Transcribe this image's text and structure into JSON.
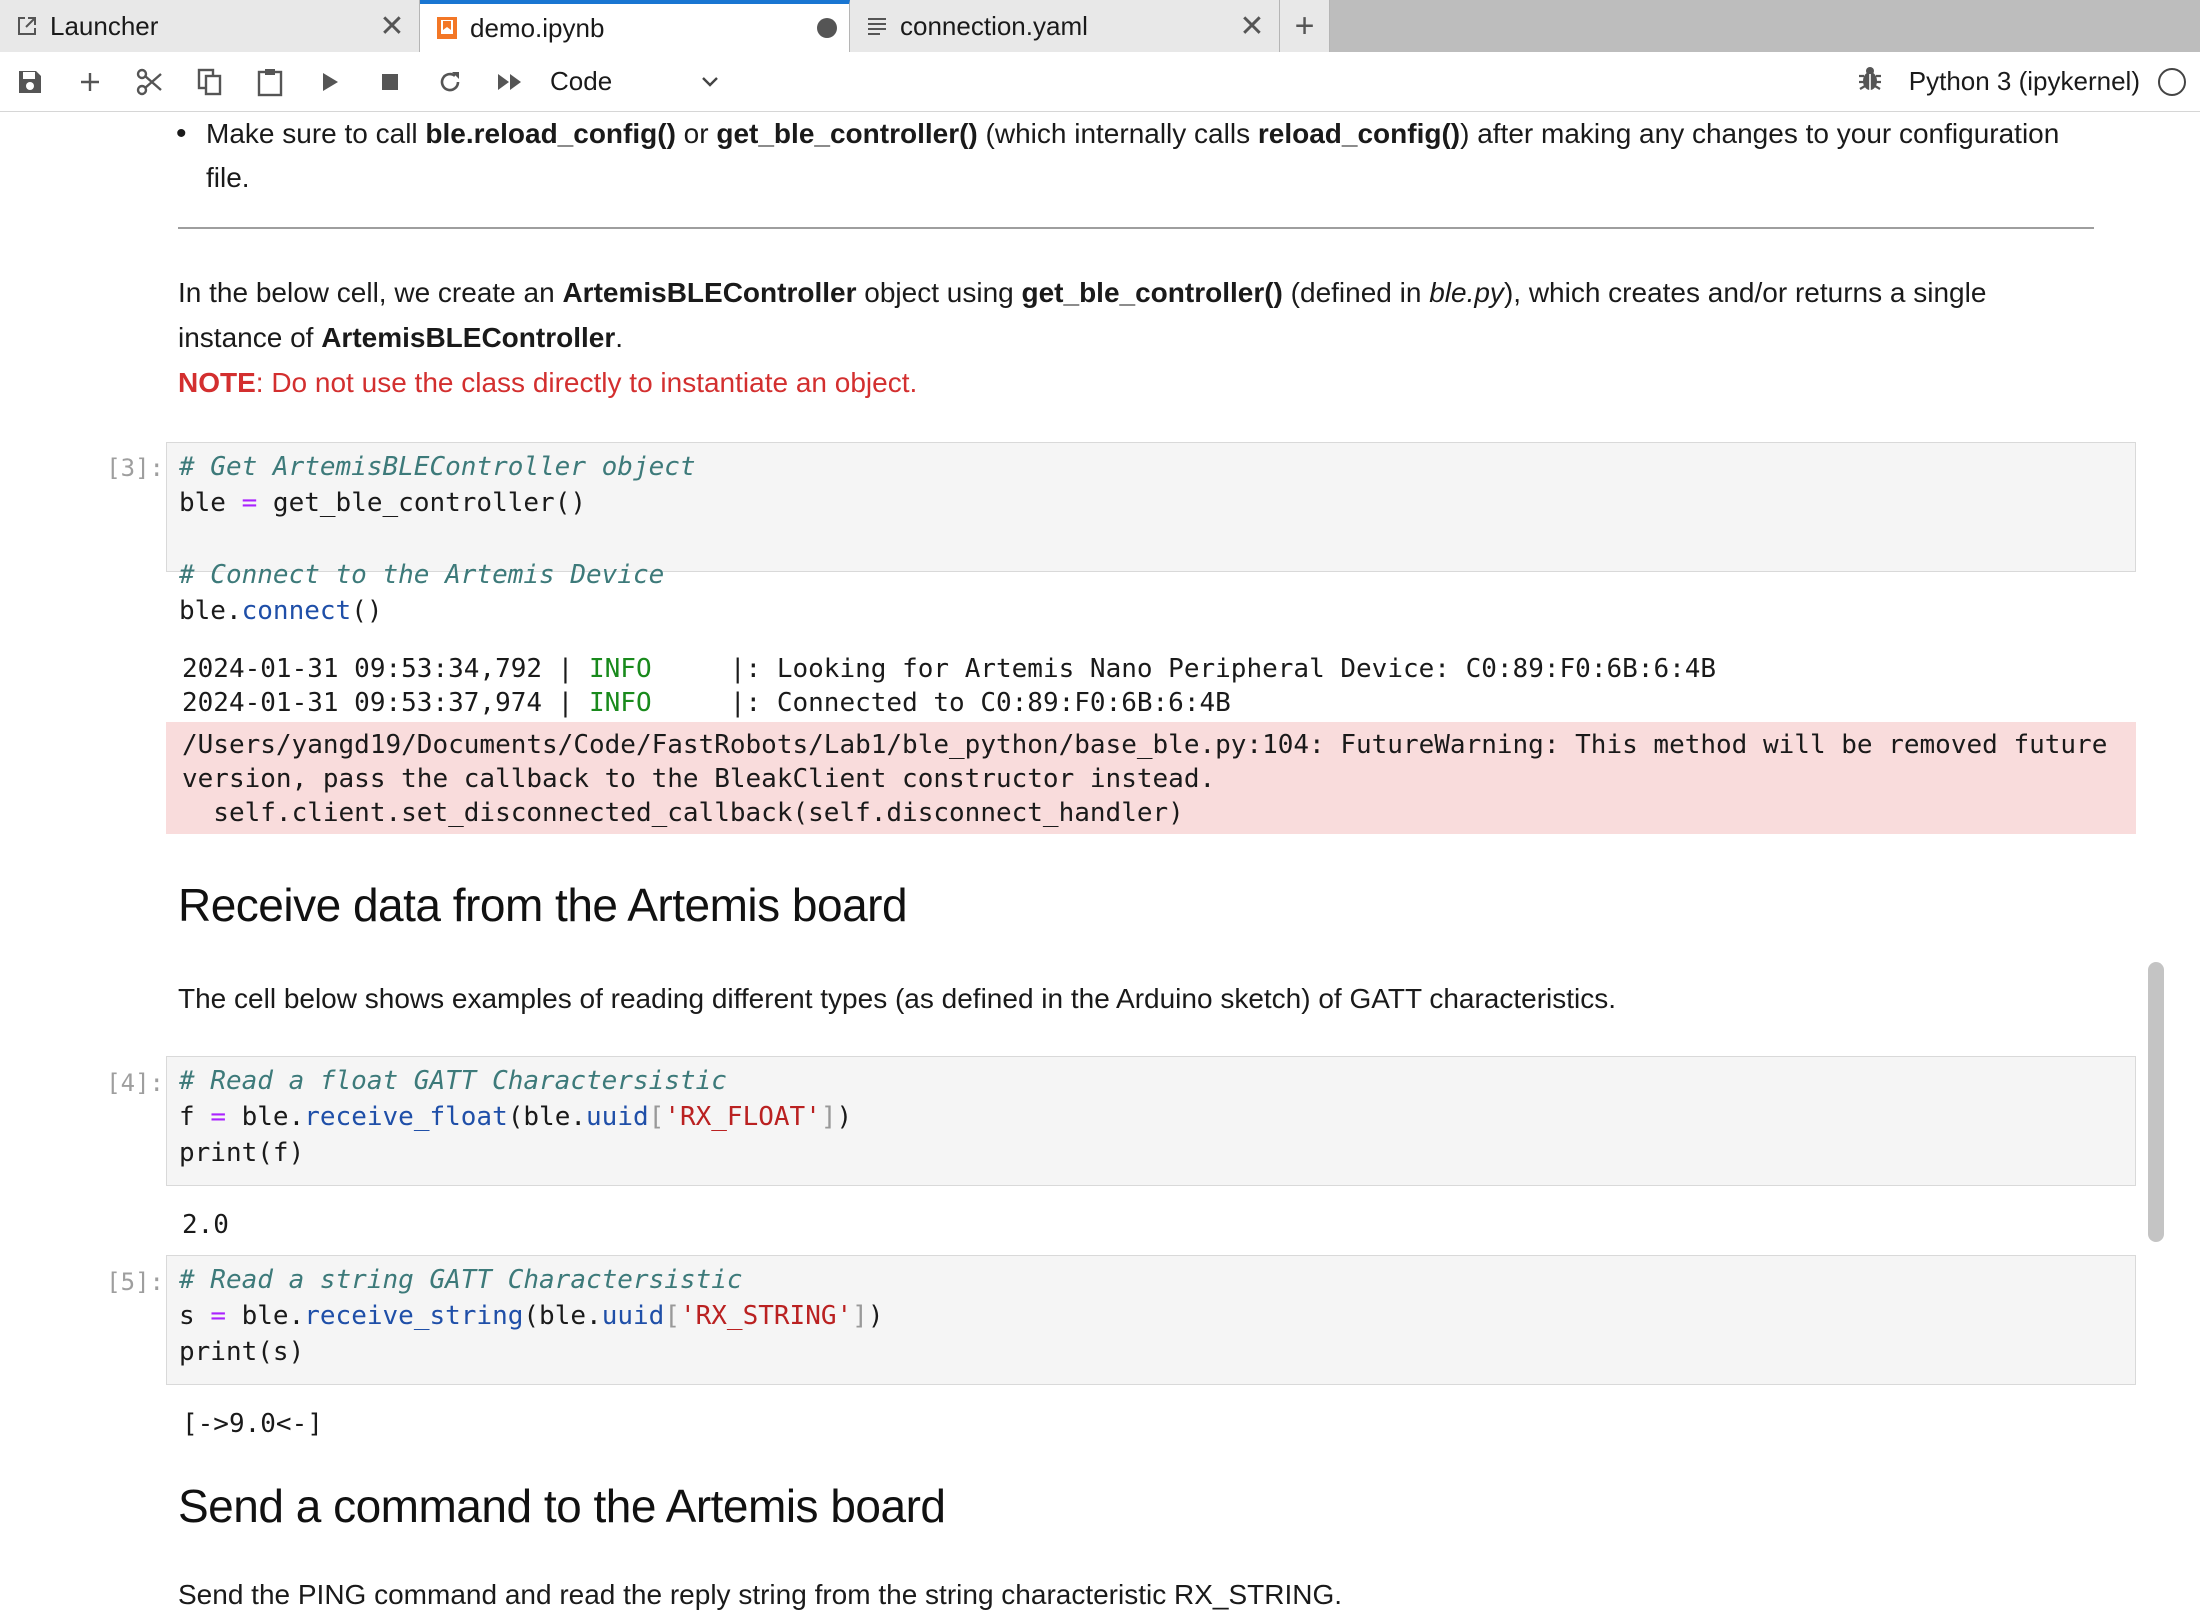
{
  "tabs": [
    {
      "label": "Launcher",
      "icon": "external-link-icon",
      "state": "close"
    },
    {
      "label": "demo.ipynb",
      "icon": "notebook-icon",
      "state": "modified"
    },
    {
      "label": "connection.yaml",
      "icon": "text-file-icon",
      "state": "close"
    }
  ],
  "toolbar": {
    "cell_type": "Code",
    "kernel_name": "Python 3 (ipykernel)",
    "icons": [
      "save-icon",
      "add-icon",
      "cut-icon",
      "copy-icon",
      "paste-icon",
      "run-icon",
      "stop-icon",
      "restart-icon",
      "fast-forward-icon",
      "debugger-icon",
      "kernel-status-icon"
    ]
  },
  "md1": {
    "t1": "Make sure to call ",
    "b1": "ble.reload_config()",
    "t2": " or ",
    "b2": "get_ble_controller()",
    "t3": " (which internally calls ",
    "b3": "reload_config()",
    "t4": ") after making any changes to your configuration file."
  },
  "md2": {
    "t1": "In the below cell, we create an ",
    "b1": "ArtemisBLEController",
    "t2": " object using ",
    "b2": "get_ble_controller()",
    "t3": " (defined in ",
    "i1": "ble.py",
    "t4": "), which creates and/or returns a single instance of ",
    "b3": "ArtemisBLEController",
    "t5": ".",
    "note_label": "NOTE",
    "note_text": ": Do not use the class directly to instantiate an object."
  },
  "cell3": {
    "prompt": "[3]:",
    "c1": "# Get ArtemisBLEController object",
    "l2a": "ble ",
    "l2op": "=",
    "l2b": " get_ble_controller()",
    "c2": "# Connect to the Artemis Device",
    "l5a": "ble.",
    "l5fn": "connect",
    "l5b": "()",
    "out1_a": "2024-01-31 09:53:34,792 | ",
    "out1_info": "INFO",
    "out1_b": "     |: Looking for Artemis Nano Peripheral Device: C0:89:F0:6B:6:4B",
    "out2_a": "2024-01-31 09:53:37,974 | ",
    "out2_info": "INFO",
    "out2_b": "     |: Connected to C0:89:F0:6B:6:4B",
    "err1": "/Users/yangd19/Documents/Code/FastRobots/Lab1/ble_python/base_ble.py:104: FutureWarning: This method will be removed future",
    "err2": "version, pass the callback to the BleakClient constructor instead.",
    "err3": "  self.client.set_disconnected_callback(self.disconnect_handler)"
  },
  "h_receive": "Receive data from the Artemis board",
  "md3": "The cell below shows examples of reading different types (as defined in the Arduino sketch) of GATT characteristics.",
  "cell4": {
    "prompt": "[4]:",
    "c1": "# Read a float GATT Charactersistic",
    "a": "f ",
    "op": "=",
    "b": " ble.",
    "fn1": "receive_float",
    "c": "(ble.",
    "fn2": "uuid",
    "br1": "[",
    "str": "'RX_FLOAT'",
    "br2": "]",
    "d": ")",
    "l3": "print(f)",
    "out": "2.0"
  },
  "cell5": {
    "prompt": "[5]:",
    "c1": "# Read a string GATT Charactersistic",
    "a": "s ",
    "op": "=",
    "b": " ble.",
    "fn1": "receive_string",
    "c": "(ble.",
    "fn2": "uuid",
    "br1": "[",
    "str": "'RX_STRING'",
    "br2": "]",
    "d": ")",
    "l3": "print(s)",
    "out": "[->9.0<-]"
  },
  "h_send": "Send a command to the Artemis board",
  "md4": "Send the PING command and read the reply string from the string characteristic RX_STRING."
}
